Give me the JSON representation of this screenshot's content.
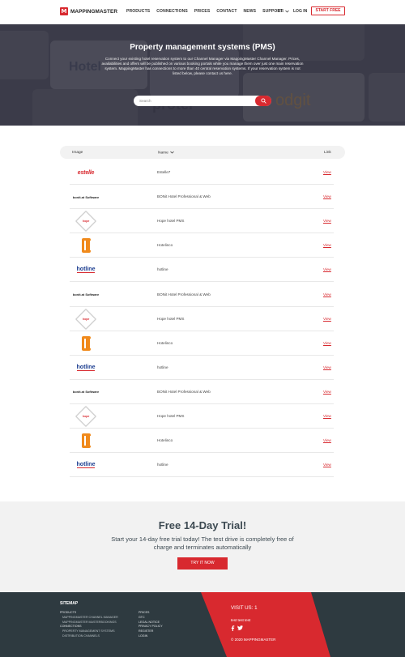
{
  "header": {
    "logo_mark": "M",
    "logo_text": "MAPPINGMASTER",
    "nav": [
      "PRODUCTS",
      "CONNECTIONS",
      "PRICES",
      "CONTACT",
      "NEWS",
      "SUPPORT"
    ],
    "lang": "EN",
    "login": "LOG IN",
    "start_free": "START FREE"
  },
  "hero": {
    "title": "Property management systems (PMS)",
    "text": "Connect your existing hotel reservation system to our Channel Manager via MappingMaster Channel Manager. Prices, availabilities and offers will be published on various booking portals while you manage them over just one main reservation system. MappingMaster has connections to more than 40 central reservation systems. If your reservation system is not listed below, please contact us here.",
    "search_placeholder": "Search",
    "bg_words": [
      "Hotel",
      "protel",
      "odgit"
    ]
  },
  "table": {
    "headers": {
      "image": "Image",
      "name": "Name",
      "link": "Link"
    },
    "rows": [
      {
        "logo": "estelle",
        "logo_text": "estelle",
        "name": "Estelle7",
        "link": "View"
      },
      {
        "logo": "bonit",
        "logo_text": "bonit.at Software",
        "name": "BONit Hotel Professional & Web",
        "link": "View"
      },
      {
        "logo": "hope",
        "logo_text": "hope",
        "name": "Hope hotel PMS",
        "link": "View"
      },
      {
        "logo": "hotelinco",
        "logo_text": "",
        "name": "Hotelinco",
        "link": "View"
      },
      {
        "logo": "hotline",
        "logo_text": "hotline",
        "name": "hotline",
        "link": "View"
      },
      {
        "logo": "bonit",
        "logo_text": "bonit.at Software",
        "name": "BONit Hotel Professional & Web",
        "link": "View"
      },
      {
        "logo": "hope",
        "logo_text": "hope",
        "name": "Hope hotel PMS",
        "link": "View"
      },
      {
        "logo": "hotelinco",
        "logo_text": "",
        "name": "Hotelinco",
        "link": "View"
      },
      {
        "logo": "hotline",
        "logo_text": "hotline",
        "name": "hotline",
        "link": "View"
      },
      {
        "logo": "bonit",
        "logo_text": "bonit.at Software",
        "name": "BONit Hotel Professional & Web",
        "link": "View"
      },
      {
        "logo": "hope",
        "logo_text": "hope",
        "name": "Hope hotel PMS",
        "link": "View"
      },
      {
        "logo": "hotelinco",
        "logo_text": "",
        "name": "Hotelinco",
        "link": "View"
      },
      {
        "logo": "hotline",
        "logo_text": "hotline",
        "name": "hotline",
        "link": "View"
      }
    ]
  },
  "trial": {
    "title": "Free 14-Day Trial!",
    "text": "Start your 14-day free trial today! The test drive is completely free of charge and terminates automatically",
    "button": "TRY IT NOW"
  },
  "footer": {
    "sitemap": "SITEMAP",
    "col1": [
      {
        "label": "PRODUCTS",
        "sub": false
      },
      {
        "label": "MAPPINGMASTER CHANNEL MANAGER",
        "sub": true
      },
      {
        "label": "MAPPINGMASTER MASTERBOOKINGS",
        "sub": true
      },
      {
        "label": "CONNECTIONS",
        "sub": false
      },
      {
        "label": "PROPERTY MANAGEMENT SYSTEMS",
        "sub": true
      },
      {
        "label": "DISTRIBUTION CHANNELS",
        "sub": true
      }
    ],
    "col2": [
      "PRICES",
      "GTC",
      "LEGAL NOTICE",
      "PRIVACY POLICY",
      "REGISTER",
      "LOGIN"
    ],
    "visit": "VISIT US: 1",
    "test": "test test test",
    "copyright": "© 2020 MAPPINGMASTER"
  },
  "colors": {
    "accent": "#d8292f",
    "footer_bg": "#2e3a40",
    "trial_bg": "#f2f2f2"
  }
}
